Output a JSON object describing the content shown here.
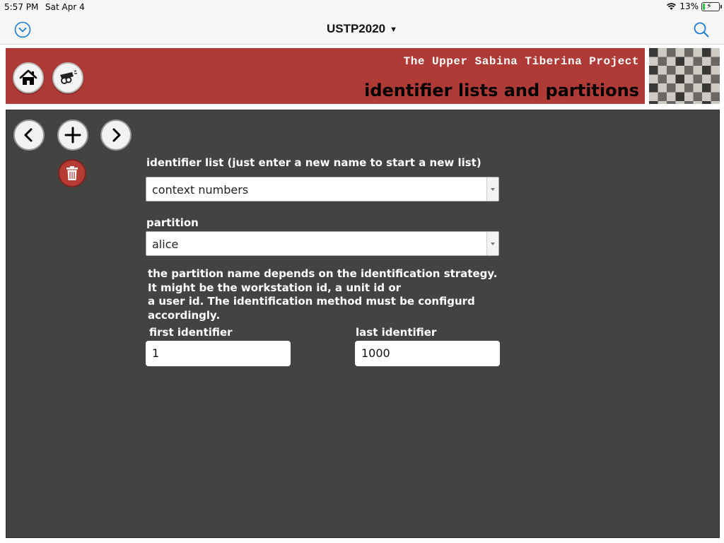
{
  "status": {
    "time": "5:57 PM",
    "date": "Sat Apr 4",
    "battery": "13%",
    "battery_level": 0.13
  },
  "nav": {
    "title": "USTP2020"
  },
  "header": {
    "project_name": "The Upper Sabina Tiberina Project",
    "page_title": "identifier lists and partitions"
  },
  "form": {
    "list_label": "identifier list (just enter a new name to start a new list)",
    "list_value": "context numbers",
    "partition_label": "partition",
    "partition_value": "alice",
    "note": [
      "the partition name depends on the identification strategy.",
      "It might be the workstation id, a unit id or",
      "a user id. The identification method must be configurd",
      "accordingly."
    ],
    "first_label": "first identifier",
    "first_value": "1",
    "last_label": "last identifier",
    "last_value": "1000"
  },
  "colors": {
    "header_red": "#b03a36",
    "panel_bg": "#434341",
    "accent_blue": "#1a7ad4"
  }
}
